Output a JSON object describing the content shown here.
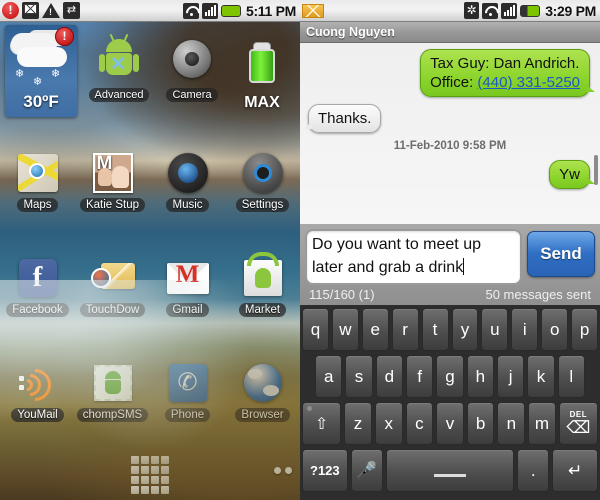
{
  "left_phone": {
    "status_bar": {
      "icons": [
        "alert-circle-icon",
        "gmail-icon",
        "warning-triangle-icon",
        "usb-icon"
      ],
      "right_icons": [
        "wifi-icon",
        "signal-icon",
        "battery-icon"
      ],
      "time": "5:11 PM"
    },
    "weather_widget": {
      "temperature": "30ºF",
      "badge": "!",
      "condition_icon": "snow-cloud-icon"
    },
    "widgets": [
      {
        "label": "Advanced",
        "icon": "android-bot-icon"
      },
      {
        "label": "Camera",
        "icon": "camera-lens-icon"
      },
      {
        "label": "MAX",
        "icon": "battery-widget-icon"
      }
    ],
    "app_rows": [
      [
        {
          "label": "Maps",
          "icon": "maps-icon"
        },
        {
          "label": "Katie Stup",
          "icon": "contact-photo-icon"
        },
        {
          "label": "Music",
          "icon": "music-icon"
        },
        {
          "label": "Settings",
          "icon": "settings-icon"
        }
      ],
      [
        {
          "label": "Facebook",
          "icon": "facebook-icon"
        },
        {
          "label": "TouchDow",
          "icon": "touchdown-icon"
        },
        {
          "label": "Gmail",
          "icon": "gmail-icon"
        },
        {
          "label": "Market",
          "icon": "market-icon"
        }
      ],
      [
        {
          "label": "YouMail",
          "icon": "youmail-icon"
        },
        {
          "label": "chompSMS",
          "icon": "chompsms-icon"
        },
        {
          "label": "Phone",
          "icon": "phone-icon"
        },
        {
          "label": "Browser",
          "icon": "browser-icon"
        }
      ]
    ],
    "dock": {
      "app_drawer_icon": "app-drawer-grid-icon",
      "page_dots": 2
    }
  },
  "right_phone": {
    "status_bar": {
      "icons": [
        "sms-envelope-icon"
      ],
      "right_icons": [
        "bluetooth-icon",
        "wifi-icon",
        "signal-icon",
        "battery-icon"
      ],
      "time": "3:29 PM"
    },
    "header": {
      "title": "Cuong Nguyen"
    },
    "messages": [
      {
        "direction": "outgoing",
        "line1": "Tax Guy: Dan Andrich.",
        "line2_prefix": "Office: ",
        "line2_link": "(440) 331-5250"
      },
      {
        "direction": "incoming",
        "text": "Thanks."
      },
      {
        "direction": "outgoing",
        "text": "Yw"
      }
    ],
    "timestamp": "11-Feb-2010 9:58 PM",
    "compose": {
      "text": "Do you want to meet up later and grab a drink",
      "send_label": "Send",
      "char_counter": "115/160 (1)",
      "messages_sent": "50 messages sent"
    },
    "keyboard": {
      "row1": [
        "q",
        "w",
        "e",
        "r",
        "t",
        "y",
        "u",
        "i",
        "o",
        "p"
      ],
      "row2": [
        "a",
        "s",
        "d",
        "f",
        "g",
        "h",
        "j",
        "k",
        "l"
      ],
      "row3_shift": "⇧",
      "row3": [
        "z",
        "x",
        "c",
        "v",
        "b",
        "n",
        "m"
      ],
      "row3_delete_label": "DEL",
      "row3_delete_glyph": "⌫",
      "row4_symbols": "?123",
      "row4_mic": "mic-icon",
      "row4_space": "space-key",
      "row4_period": ".",
      "row4_enter": "↵"
    }
  },
  "colors": {
    "bubble_out": "#8fd62f",
    "bubble_in": "#e9e9e9",
    "send_button": "#2f6fc4",
    "link": "#1a58c8",
    "keyboard_bg": "#2d2d2d"
  }
}
